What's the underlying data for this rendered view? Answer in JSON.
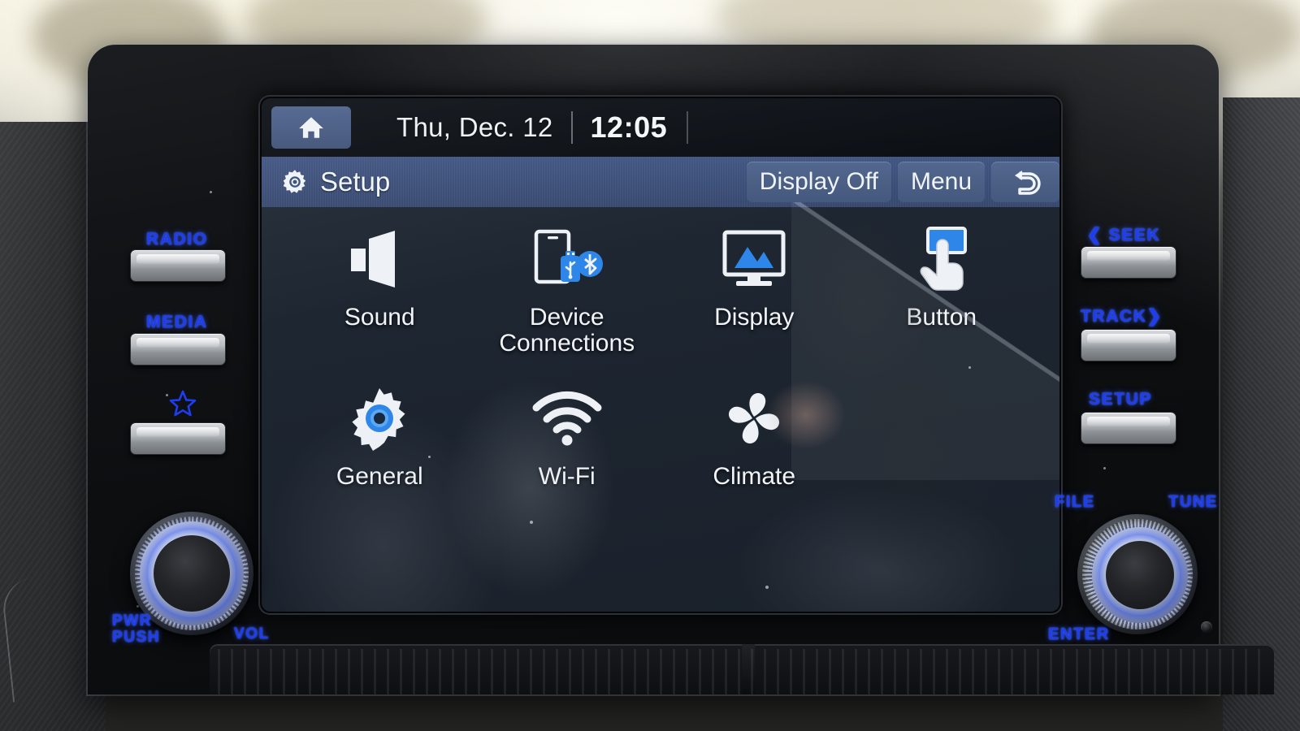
{
  "screen": {
    "status": {
      "home_icon": "home-icon",
      "date": "Thu, Dec. 12",
      "time": "12:05"
    },
    "title_bar": {
      "gear_icon": "gear-icon",
      "title": "Setup",
      "buttons": [
        {
          "label": "Display Off",
          "name": "display-off-button"
        },
        {
          "label": "Menu",
          "name": "menu-button"
        },
        {
          "label": "",
          "name": "back-button",
          "icon": "back-arrow-icon"
        }
      ]
    },
    "menu_rows": [
      [
        {
          "label": "Sound",
          "icon": "speaker-icon"
        },
        {
          "label": "Device\nConnections",
          "line1": "Device",
          "line2": "Connections",
          "icon": "phone-usb-bluetooth-icon"
        },
        {
          "label": "Display",
          "icon": "monitor-icon"
        },
        {
          "label": "Button",
          "icon": "hand-press-icon"
        }
      ],
      [
        {
          "label": "General",
          "icon": "gear-blue-icon"
        },
        {
          "label": "Wi-Fi",
          "icon": "wifi-icon"
        },
        {
          "label": "Climate",
          "icon": "fan-icon"
        }
      ]
    ]
  },
  "hardware": {
    "left_labels": [
      {
        "text": "RADIO",
        "name": "radio-label"
      },
      {
        "text": "MEDIA",
        "name": "media-label"
      }
    ],
    "favorite_icon": "star-icon",
    "right_labels": [
      {
        "text": "SEEK",
        "prefix": "❮",
        "name": "seek-label"
      },
      {
        "text": "TRACK",
        "suffix": "❯",
        "name": "track-label"
      },
      {
        "text": "SETUP",
        "name": "setup-label"
      }
    ],
    "left_knob": {
      "label_line1": "PWR",
      "label_line2": "PUSH",
      "volume_label": "VOL"
    },
    "right_knob": {
      "file_label": "FILE",
      "tune_label": "TUNE",
      "enter_label": "ENTER"
    }
  },
  "colors": {
    "accent_blue": "#1f3df0",
    "title_bar_blue": "#3f5481",
    "button_blue": "#53688f",
    "icon_blue": "#1f7fe0",
    "screen_bg": "#1e2530",
    "text_white": "#f1f5f9"
  }
}
